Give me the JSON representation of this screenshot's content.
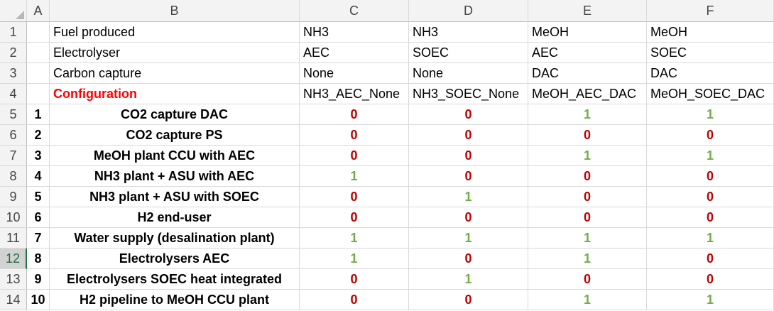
{
  "columns": [
    "A",
    "B",
    "C",
    "D",
    "E",
    "F"
  ],
  "header_rows": [
    {
      "row": "1",
      "label": "Fuel produced",
      "values": [
        "NH3",
        "NH3",
        "MeOH",
        "MeOH"
      ]
    },
    {
      "row": "2",
      "label": "Electrolyser",
      "values": [
        "AEC",
        "SOEC",
        "AEC",
        "SOEC"
      ]
    },
    {
      "row": "3",
      "label": "Carbon capture",
      "values": [
        "None",
        "None",
        "DAC",
        "DAC"
      ]
    },
    {
      "row": "4",
      "label": "Configuration",
      "values": [
        "NH3_AEC_None",
        "NH3_SOEC_None",
        "MeOH_AEC_DAC",
        "MeOH_SOEC_DAC"
      ]
    }
  ],
  "data_rows": [
    {
      "row": "5",
      "num": "1",
      "label": "CO2 capture DAC",
      "values": [
        "0",
        "0",
        "1",
        "1"
      ]
    },
    {
      "row": "6",
      "num": "2",
      "label": "CO2 capture PS",
      "values": [
        "0",
        "0",
        "0",
        "0"
      ]
    },
    {
      "row": "7",
      "num": "3",
      "label": "MeOH plant CCU with AEC",
      "values": [
        "0",
        "0",
        "1",
        "1"
      ]
    },
    {
      "row": "8",
      "num": "4",
      "label": "NH3 plant + ASU with AEC",
      "values": [
        "1",
        "0",
        "0",
        "0"
      ]
    },
    {
      "row": "9",
      "num": "5",
      "label": "NH3 plant + ASU with SOEC",
      "values": [
        "0",
        "1",
        "0",
        "0"
      ]
    },
    {
      "row": "10",
      "num": "6",
      "label": "H2 end-user",
      "values": [
        "0",
        "0",
        "0",
        "0"
      ]
    },
    {
      "row": "11",
      "num": "7",
      "label": "Water supply (desalination plant)",
      "values": [
        "1",
        "1",
        "1",
        "1"
      ]
    },
    {
      "row": "12",
      "num": "8",
      "label": "Electrolysers AEC",
      "values": [
        "1",
        "0",
        "1",
        "0"
      ]
    },
    {
      "row": "13",
      "num": "9",
      "label": "Electrolysers SOEC heat integrated",
      "values": [
        "0",
        "1",
        "0",
        "0"
      ]
    },
    {
      "row": "14",
      "num": "10",
      "label": "H2 pipeline to MeOH CCU plant",
      "values": [
        "0",
        "0",
        "1",
        "1"
      ]
    }
  ],
  "selected_row": "12",
  "colors": {
    "zero": "#c00000",
    "one": "#70ad47",
    "configuration_label": "#ff0000"
  }
}
